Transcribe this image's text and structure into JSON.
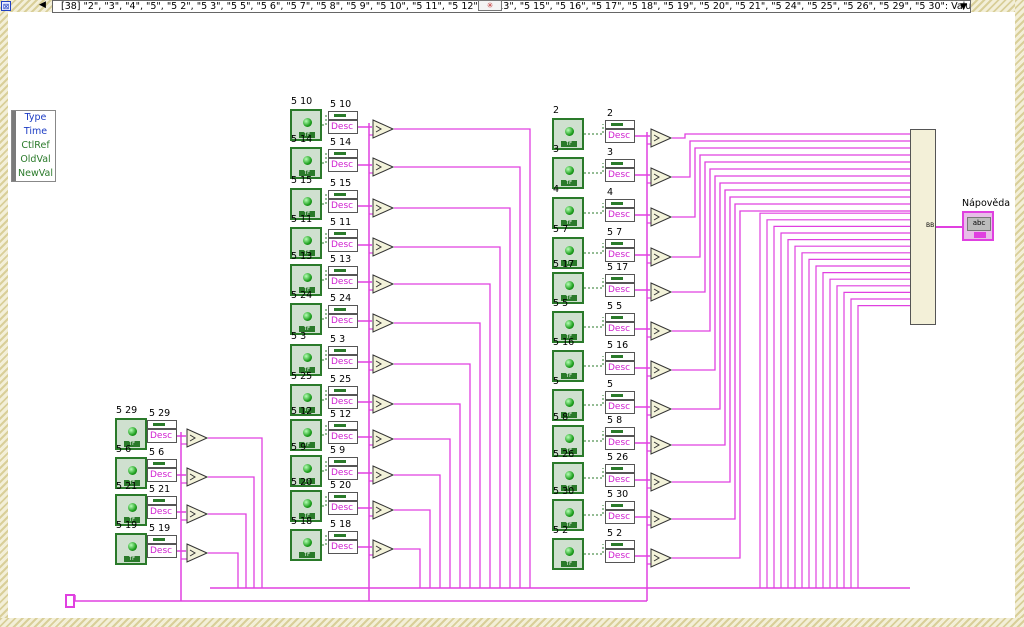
{
  "case_header": {
    "text": "[38] \"2\", \"3\", \"4\", \"5\", \"5 2\", \"5 3\", \"5 5\", \"5 6\", \"5 7\", \"5 8\", \"5 9\", \"5 10\", \"5 11\", \"5 12\", \"5 13\", \"5 15\", \"5 16\", \"5 17\", \"5 18\", \"5 19\", \"5 20\", \"5 21\", \"5 24\", \"5 25\", \"5 26\", \"5 29\", \"5 30\": Value Change",
    "dropdown_icon": "triangle-down-icon",
    "add_icon": "add-case-icon",
    "colors": {
      "accent": "#e040e0",
      "control": "#2a7a2a",
      "frame": "#d9cf99"
    }
  },
  "event_data_node": {
    "items": [
      "Type",
      "Time",
      "CtlRef",
      "OldVal",
      "NewVal"
    ]
  },
  "indicator": {
    "label": "Nápověda",
    "type_tag": "abc"
  },
  "build_array": {
    "label": "BB"
  },
  "prop_node_label": "Desc",
  "group_a": {
    "controls": [
      "5 29",
      "5 6",
      "5 21",
      "5 19"
    ],
    "props": [
      "5 29",
      "5 6",
      "5 21",
      "5 19"
    ]
  },
  "group_b": {
    "controls": [
      "5 10",
      "5 14",
      "5 15",
      "5 11",
      "5 13",
      "5 24",
      "5 3",
      "5 25",
      "5 12",
      "5 9",
      "5 20",
      "5 18"
    ],
    "props": [
      "5 10",
      "5 14",
      "5 15",
      "5 11",
      "5 13",
      "5 24",
      "5 3",
      "5 25",
      "5 12",
      "5 9",
      "5 20",
      "5 18"
    ]
  },
  "group_c": {
    "controls": [
      "2",
      "3",
      "4",
      "5 7",
      "5 17",
      "5 5",
      "5 16",
      "5",
      "5 8",
      "5 26",
      "5 30",
      "5 2"
    ],
    "props": [
      "2",
      "3",
      "4",
      "5 7",
      "5 17",
      "5 5",
      "5 16",
      "5",
      "5 8",
      "5 26",
      "5 30",
      "5 2"
    ]
  }
}
